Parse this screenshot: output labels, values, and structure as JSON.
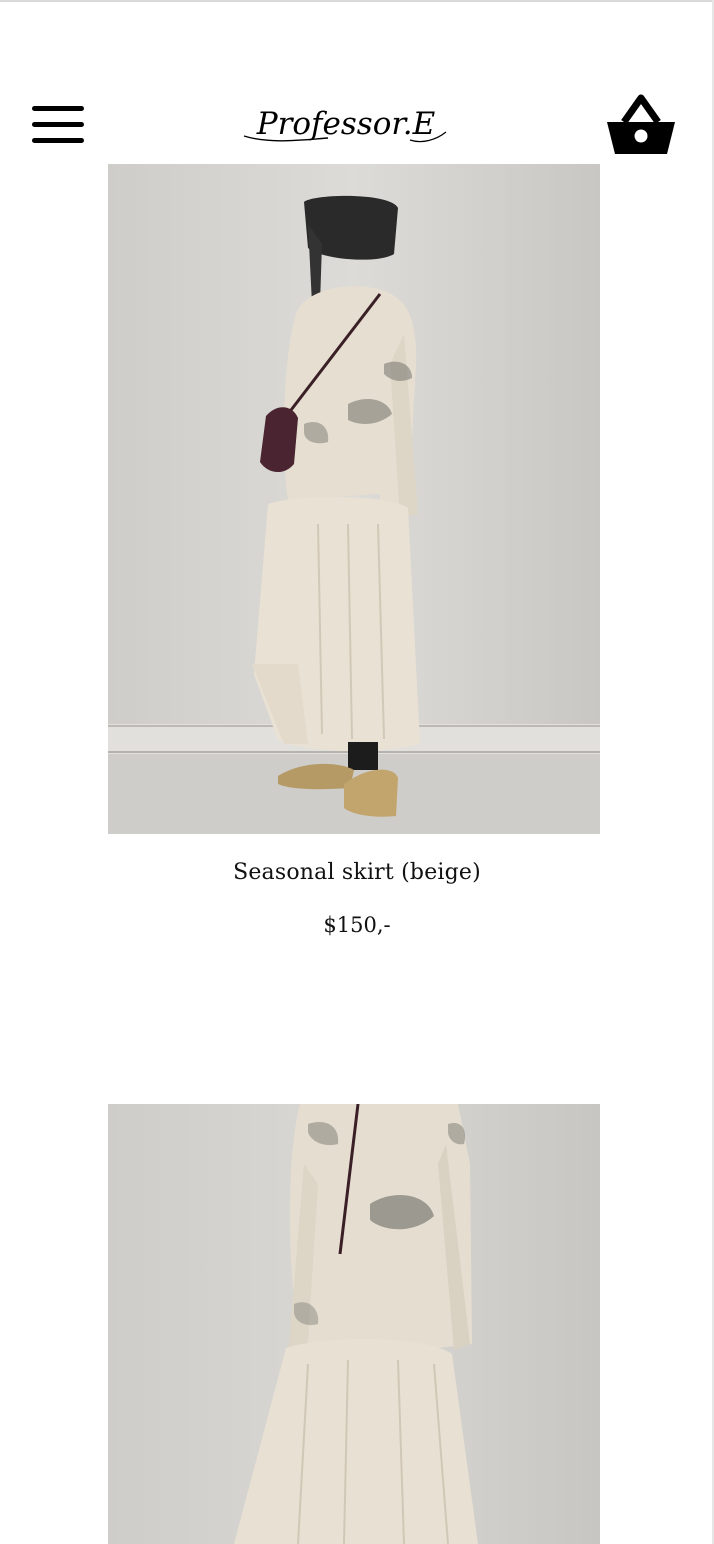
{
  "header": {
    "menu_icon": "hamburger-menu-icon",
    "logo_text": "Professor.E",
    "cart_icon": "shopping-basket-icon"
  },
  "products": [
    {
      "name": "Seasonal skirt (beige)",
      "price": "$150,-"
    }
  ],
  "colors": {
    "background": "#ffffff",
    "text": "#111111",
    "icon": "#000000",
    "photo_backdrop": "#d8d6d2",
    "garment": "#e4dccd"
  }
}
